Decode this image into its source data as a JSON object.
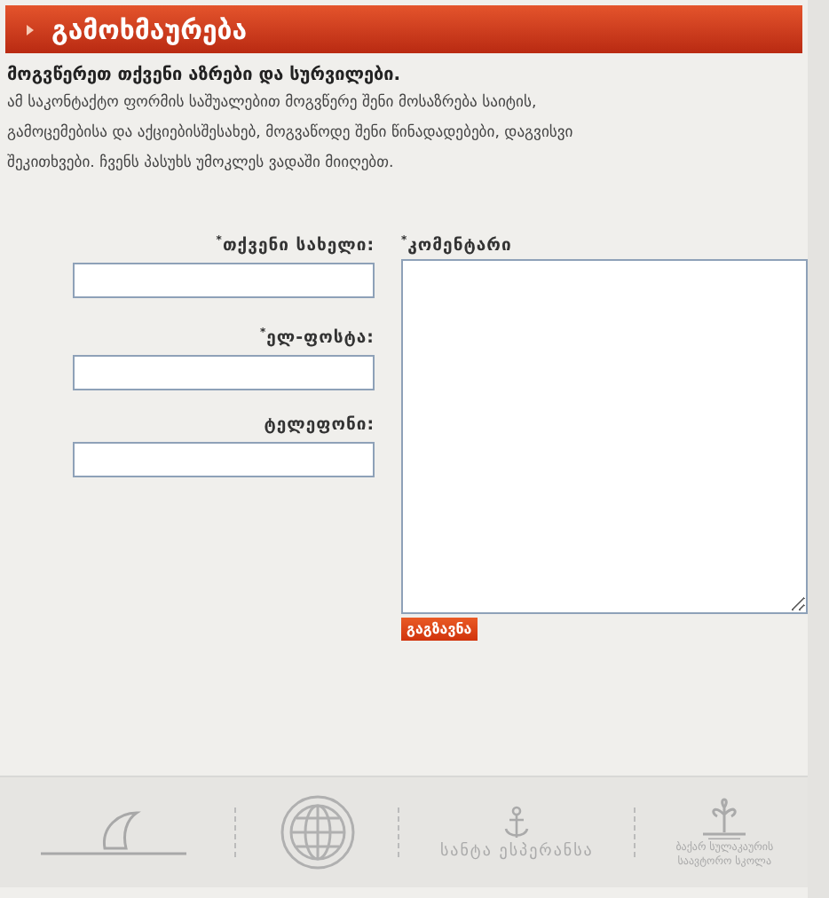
{
  "header": {
    "title": "გამოხმაურება"
  },
  "intro": {
    "heading": "მოგვწერეთ თქვენი აზრები და სურვილები.",
    "text": "ამ საკონტაქტო ფორმის საშუალებით მოგვწერე შენი მოსაზრება საიტის, გამოცემებისა და აქციებისშესახებ, მოგვაწოდე შენი წინადადებები, დაგვისვი შეკითხვები. ჩვენს პასუხს უმოკლეს ვადაში მიიღებთ."
  },
  "fields": [
    {
      "mark": "*",
      "label": "თქვენი სახელი:"
    },
    {
      "mark": "*",
      "label": "ელ-ფოსტა:"
    },
    {
      "label": "ტელეფონი:"
    }
  ],
  "comment": {
    "mark": "*",
    "label": "კომენტარი"
  },
  "submit": "გაგზავნა",
  "footer_logos": [
    {
      "kind": "sail"
    },
    {
      "kind": "globe"
    },
    {
      "kind": "anchor",
      "texts": [
        "სანტა ესპერანსა"
      ]
    },
    {
      "kind": "tree",
      "texts": [
        "ბაქარ სულაკაურის",
        "საავტორო სკოლა"
      ]
    }
  ]
}
